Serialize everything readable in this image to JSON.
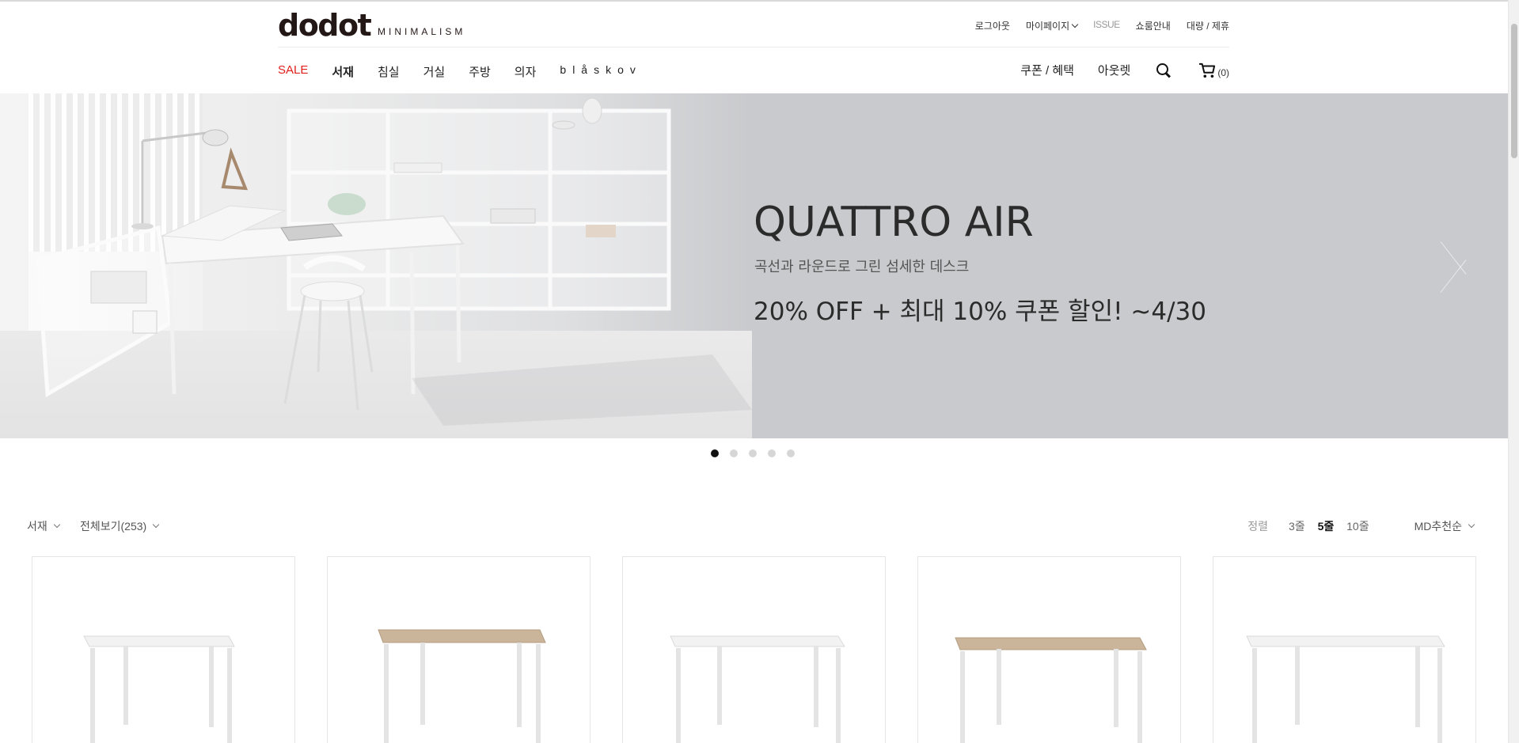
{
  "brand": {
    "logo": "dodot",
    "tagline": "MINIMALISM"
  },
  "util_menu": {
    "logout": "로그아웃",
    "mypage": "마이페이지",
    "issue": "ISSUE",
    "showroom": "쇼룸안내",
    "bulk": "대량 / 제휴"
  },
  "gnb": {
    "items": [
      "SALE",
      "서재",
      "침실",
      "거실",
      "주방",
      "의자",
      "blåskov"
    ],
    "sale_color": "#e0201b"
  },
  "gnb_right": {
    "coupon": "쿠폰 / 혜택",
    "outlet": "아웃렛",
    "search_icon": "search-icon",
    "cart_icon": "cart-icon",
    "cart_count": "(0)"
  },
  "hero": {
    "title": "QUATTRO AIR",
    "subtitle": "곡선과 라운드로 그린 섬세한 데스크",
    "promo": "20% OFF + 최대 10% 쿠폰 할인! ~4/30",
    "background": "#c9cacd",
    "slide_count": 5,
    "active_slide": 1
  },
  "listing": {
    "category": "서재",
    "filter": "전체보기(253)",
    "sort_label": "정렬",
    "column_options": [
      "3줄",
      "5줄",
      "10줄"
    ],
    "active_columns": "5줄",
    "sort_option": "MD추천순"
  },
  "products": [
    {
      "top_color": "#f2f2f2"
    },
    {
      "top_color": "#cbb59a"
    },
    {
      "top_color": "#f2f2f2"
    },
    {
      "top_color": "#cbb59a"
    },
    {
      "top_color": "#f2f2f2"
    }
  ]
}
